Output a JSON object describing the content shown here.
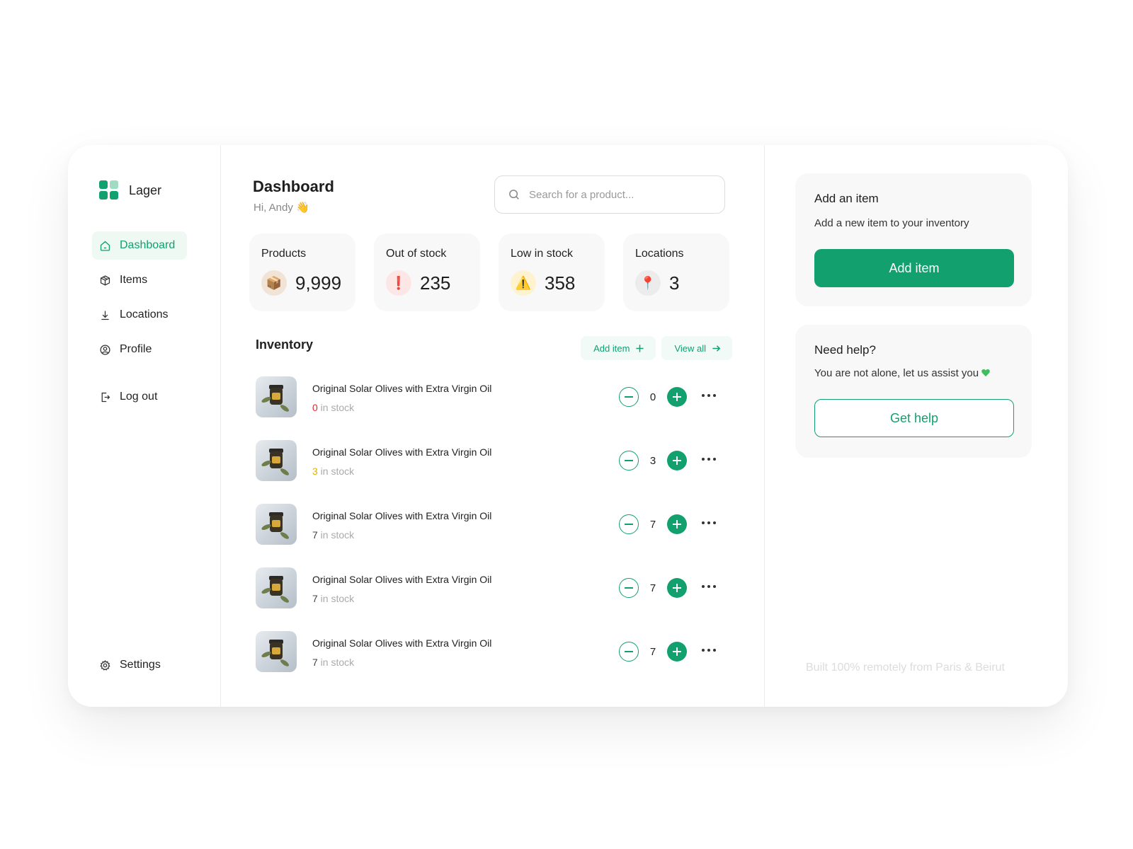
{
  "brand": {
    "name": "Lager",
    "accent": "#12a06e"
  },
  "nav": {
    "items": [
      {
        "label": "Dashboard",
        "icon": "home-icon",
        "active": true
      },
      {
        "label": "Items",
        "icon": "box-icon"
      },
      {
        "label": "Locations",
        "icon": "download-icon"
      },
      {
        "label": "Profile",
        "icon": "user-circle-icon"
      }
    ],
    "logout": "Log out",
    "settings": "Settings"
  },
  "header": {
    "title": "Dashboard",
    "greeting": "Hi, Andy 👋",
    "search_placeholder": "Search for a product..."
  },
  "stats": [
    {
      "label": "Products",
      "value": "9,999",
      "icon": "📦",
      "icon_bg": "#f1e4d6"
    },
    {
      "label": "Out of stock",
      "value": "235",
      "icon": "❗",
      "icon_bg": "#fde6e6"
    },
    {
      "label": "Low in stock",
      "value": "358",
      "icon": "⚠️",
      "icon_bg": "#fff3cf"
    },
    {
      "label": "Locations",
      "value": "3",
      "icon": "📍",
      "icon_bg": "#ececec"
    }
  ],
  "inventory": {
    "title": "Inventory",
    "add_label": "Add item",
    "view_all_label": "View all",
    "rows": [
      {
        "name": "Original Solar Olives with Extra Virgin Oil",
        "stock": "0",
        "stock_suffix": " in stock",
        "qty": "0",
        "stock_color": "red"
      },
      {
        "name": "Original Solar Olives with Extra Virgin Oil",
        "stock": "3",
        "stock_suffix": " in stock",
        "qty": "3",
        "stock_color": "yellow"
      },
      {
        "name": "Original Solar Olives with Extra Virgin Oil",
        "stock": "7",
        "stock_suffix": " in stock",
        "qty": "7",
        "stock_color": "normal"
      },
      {
        "name": "Original Solar Olives with Extra Virgin Oil",
        "stock": "7",
        "stock_suffix": " in stock",
        "qty": "7",
        "stock_color": "normal"
      },
      {
        "name": "Original Solar Olives with Extra Virgin Oil",
        "stock": "7",
        "stock_suffix": " in stock",
        "qty": "7",
        "stock_color": "normal"
      }
    ]
  },
  "add_card": {
    "title": "Add an item",
    "subtitle": "Add a new item to your inventory",
    "button": "Add item"
  },
  "help_card": {
    "title": "Need help?",
    "subtitle": "You are not alone, let us assist you",
    "button": "Get help"
  },
  "footer": {
    "note": "Built 100% remotely from Paris & Beirut"
  }
}
